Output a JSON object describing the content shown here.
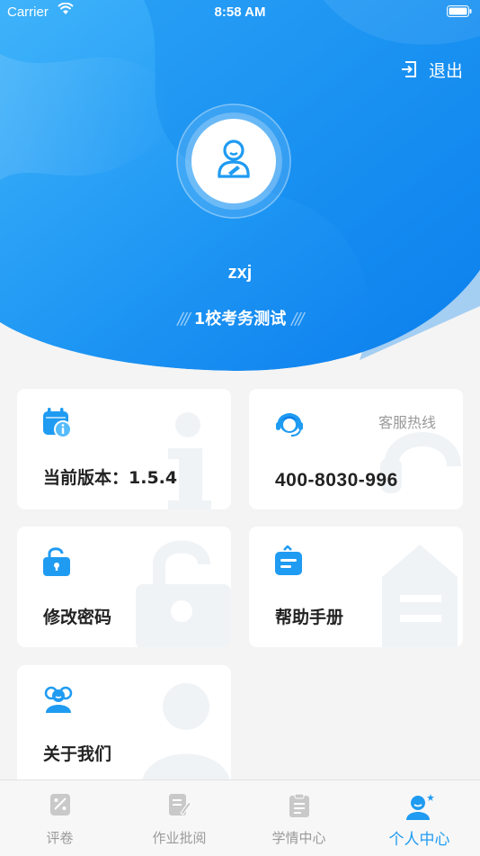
{
  "status_bar": {
    "carrier": "Carrier",
    "time": "8:58 AM"
  },
  "header": {
    "logout_label": "退出",
    "username": "zxj",
    "school": "1校考务测试",
    "school_mark": "///"
  },
  "cards": {
    "version": {
      "label": "当前版本：1.5.4",
      "icon": "calendar-info-icon"
    },
    "service": {
      "hotline_label": "客服热线",
      "phone": "400-8030-996",
      "icon": "customer-service-icon"
    },
    "password": {
      "label": "修改密码",
      "icon": "unlock-icon"
    },
    "manual": {
      "label": "帮助手册",
      "icon": "manual-icon"
    },
    "about": {
      "label": "关于我们",
      "icon": "users-icon"
    }
  },
  "tabbar": {
    "tabs": [
      {
        "label": "评卷",
        "icon": "grading-icon",
        "active": false
      },
      {
        "label": "作业批阅",
        "icon": "homework-edit-icon",
        "active": false
      },
      {
        "label": "学情中心",
        "icon": "report-icon",
        "active": false
      },
      {
        "label": "个人中心",
        "icon": "profile-icon",
        "active": true
      }
    ]
  },
  "colors": {
    "accent": "#1f9bf2",
    "header_light": "#49b8fb",
    "header_dark": "#0a7cee",
    "background": "#f4f4f4"
  }
}
